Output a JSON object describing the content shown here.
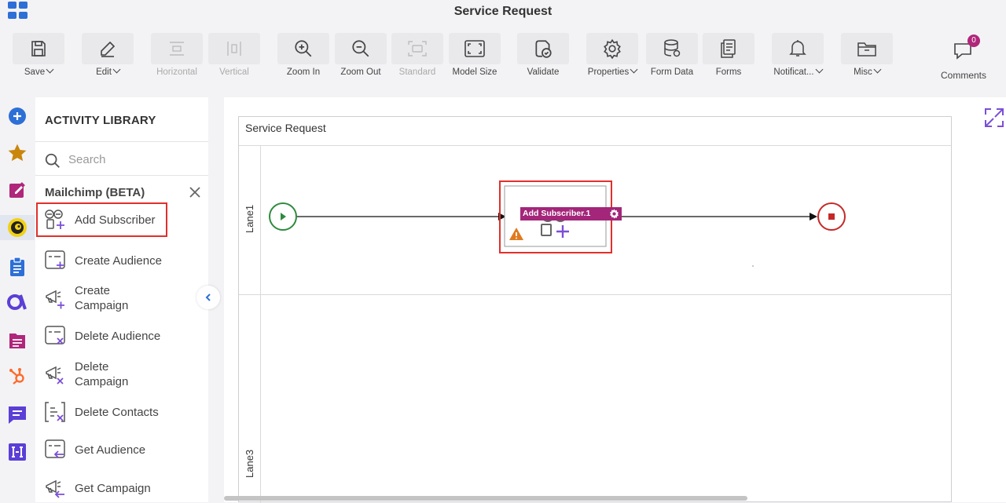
{
  "app": {
    "title": "Service Request"
  },
  "toolbar": {
    "items": [
      {
        "label": "Save",
        "icon": "save-icon",
        "caret": true
      },
      {
        "label": "Edit",
        "icon": "pencil-icon",
        "caret": true
      },
      {
        "label": "Horizontal",
        "icon": "horizontal-icon",
        "disabled": true
      },
      {
        "label": "Vertical",
        "icon": "vertical-icon",
        "disabled": true
      },
      {
        "label": "Zoom In",
        "icon": "zoom-in-icon"
      },
      {
        "label": "Zoom Out",
        "icon": "zoom-out-icon"
      },
      {
        "label": "Standard",
        "icon": "standard-icon",
        "disabled": true
      },
      {
        "label": "Model Size",
        "icon": "model-size-icon"
      },
      {
        "label": "Validate",
        "icon": "validate-icon"
      },
      {
        "label": "Properties",
        "icon": "gear-icon",
        "caret": true
      },
      {
        "label": "Form Data",
        "icon": "database-icon"
      },
      {
        "label": "Forms",
        "icon": "forms-icon"
      },
      {
        "label": "Notificat...",
        "icon": "bell-icon",
        "caret": true
      },
      {
        "label": "Misc",
        "icon": "folder-icon",
        "caret": true
      }
    ],
    "comments": {
      "label": "Comments",
      "count": "0"
    }
  },
  "library": {
    "title": "ACTIVITY LIBRARY",
    "search_placeholder": "Search",
    "section": "Mailchimp (BETA)",
    "items": [
      {
        "label": "Add Subscriber",
        "selected": true
      },
      {
        "label": "Create Audience"
      },
      {
        "label": "Create\nCampaign"
      },
      {
        "label": "Delete Audience"
      },
      {
        "label": "Delete\nCampaign"
      },
      {
        "label": "Delete Contacts"
      },
      {
        "label": "Get Audience"
      },
      {
        "label": "Get Campaign"
      }
    ]
  },
  "diagram": {
    "pool_title": "Service Request",
    "lanes": [
      "Lane1",
      "Lane3"
    ],
    "task_label": "Add Subscriber.1"
  },
  "colors": {
    "accent": "#a3267a",
    "start": "#2e8b3d",
    "end": "#c62828",
    "selection": "#e0302c",
    "brand_blue": "#2d6fd6"
  }
}
